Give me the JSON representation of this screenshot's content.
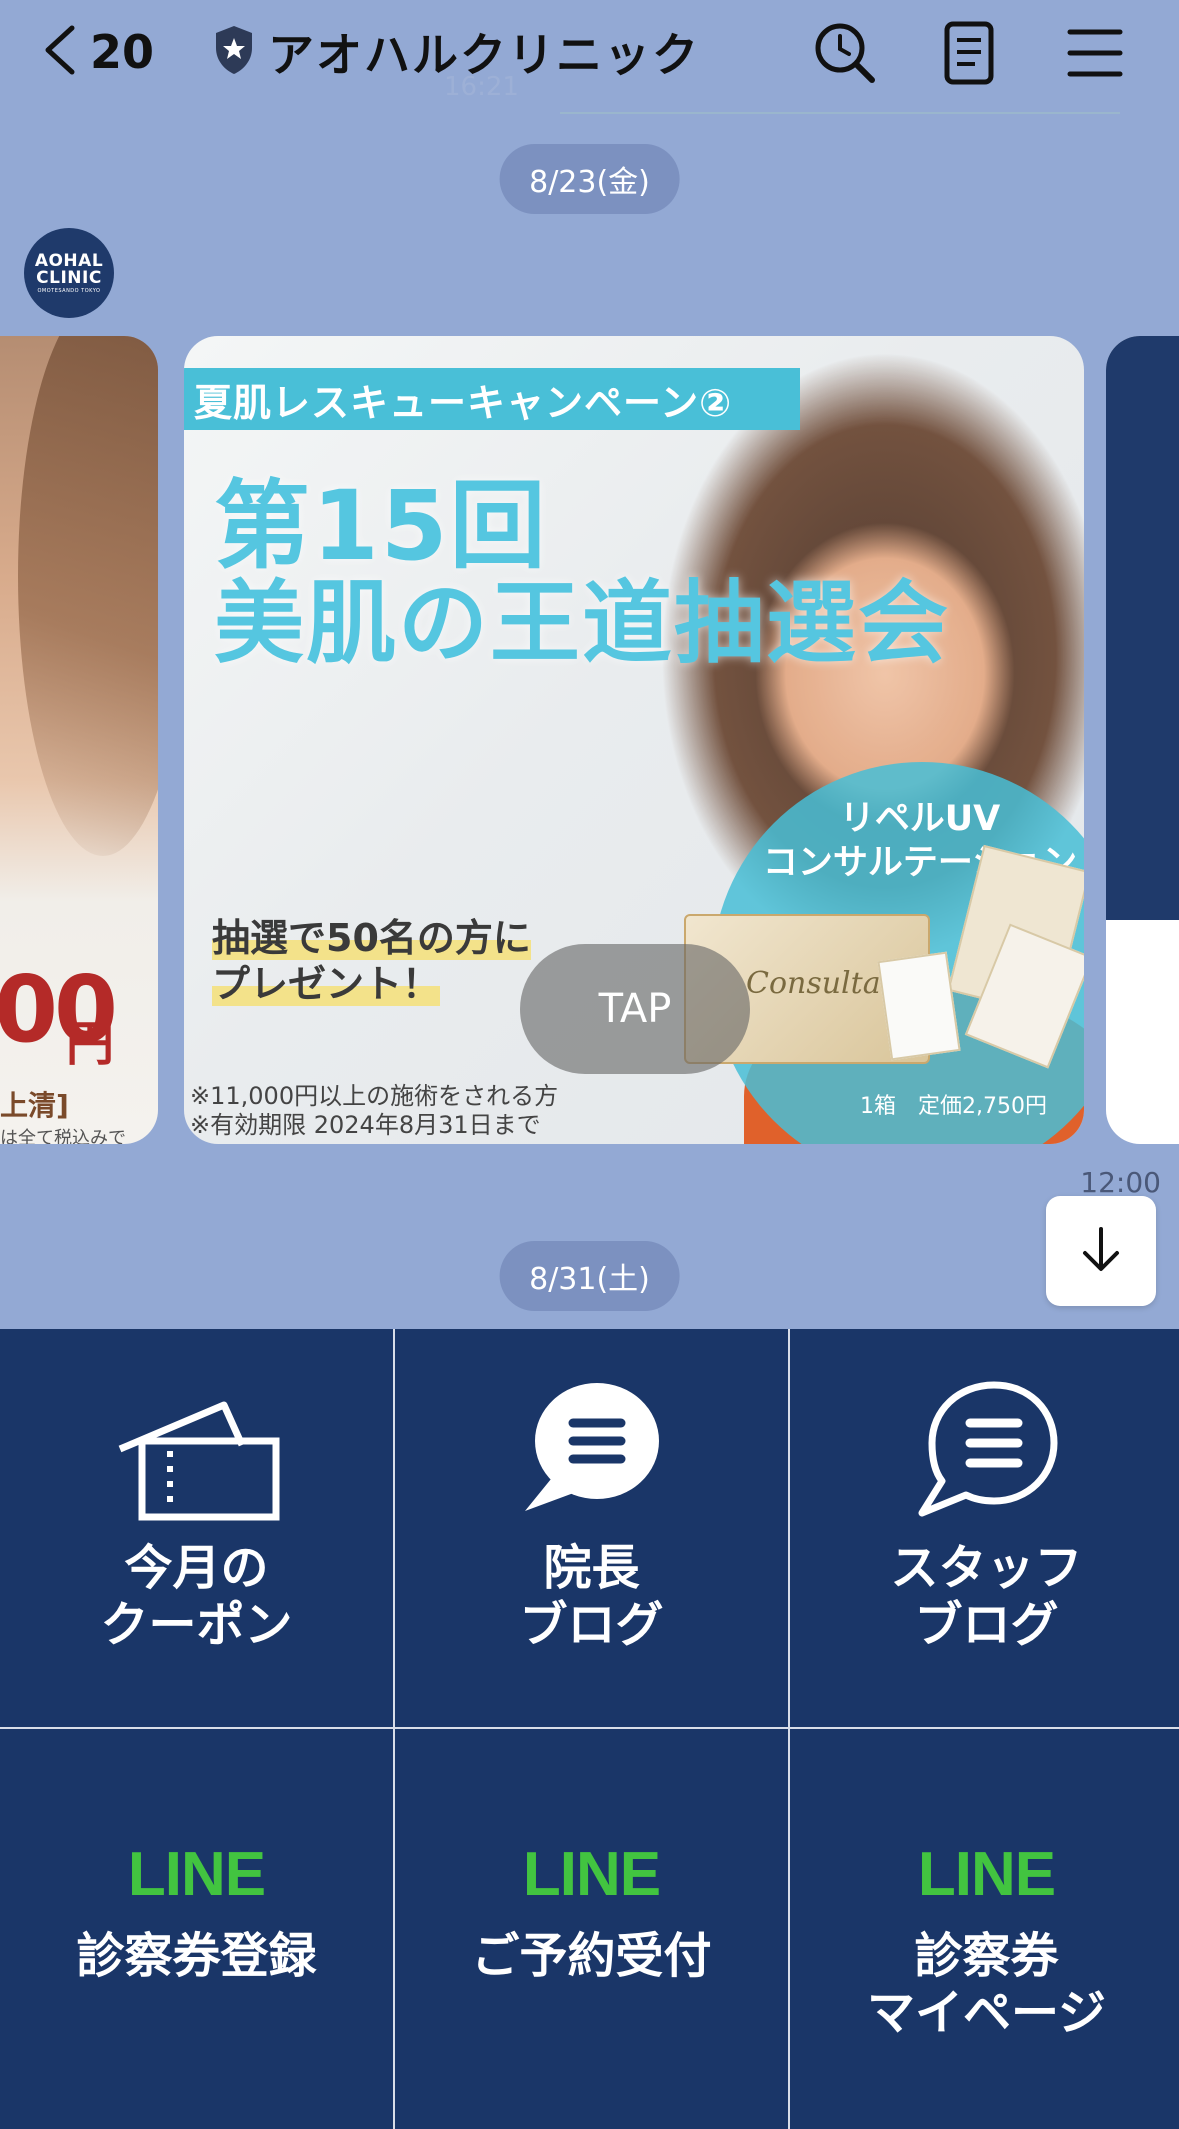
{
  "header": {
    "back_count": "20",
    "title": "アオハルクリニック",
    "ghost_time": "16:21"
  },
  "dates": {
    "first": "8/23(金)",
    "second": "8/31(土)"
  },
  "avatar": {
    "line1": "AOHAL",
    "line2": "CLINIC",
    "line3": "OMOTESANDO TOKYO"
  },
  "carousel": {
    "left_card": {
      "price": "00",
      "yen": "円",
      "bracket": "上清]",
      "tax": "は全て税込みで"
    },
    "main_card": {
      "banner": "夏肌レスキューキャンペーン②",
      "headline_1": "第15回",
      "headline_2": "美肌の王道抽選会",
      "lottery_1": "抽選で50名の方に",
      "lottery_2": "プレゼント！",
      "uv_title_1": "リペルUV",
      "uv_title_2": "コンサルテーション",
      "product_label": "Consultation",
      "box_price": "1箱　定価2,750円",
      "note_1": "※11,000円以上の施術をされる方",
      "note_2": "※有効期限 2024年8月31日まで",
      "tap": "TAP"
    }
  },
  "message_time": "12:00",
  "rich_menu": [
    {
      "icon": "ticket-icon",
      "label": "今月の\nクーポン"
    },
    {
      "icon": "speech-bubble-filled-icon",
      "label": "院長\nブログ"
    },
    {
      "icon": "speech-bubble-outline-icon",
      "label": "スタッフ\nブログ"
    },
    {
      "logo": "LINE",
      "label": "診察券登録"
    },
    {
      "logo": "LINE",
      "label": "ご予約受付"
    },
    {
      "logo": "LINE",
      "label": "診察券\nマイページ"
    }
  ],
  "colors": {
    "background": "#93a9d4",
    "menu_navy": "#1a3668",
    "line_green": "#42c440",
    "accent_cyan": "#49bfd7"
  }
}
